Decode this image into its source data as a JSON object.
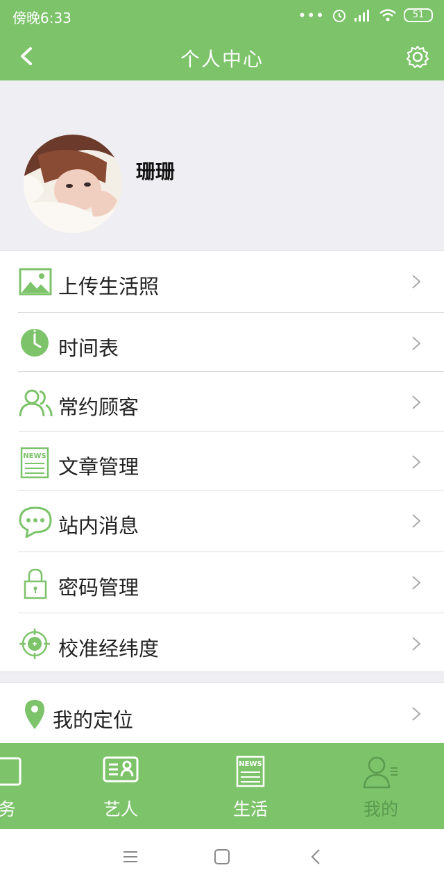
{
  "status_bar": {
    "time": "傍晚6:33",
    "battery": "51"
  },
  "nav": {
    "title": "个人中心"
  },
  "profile": {
    "username": "珊珊"
  },
  "menu": [
    {
      "label": "上传生活照",
      "icon": "picture-icon"
    },
    {
      "label": "时间表",
      "icon": "clock-icon"
    },
    {
      "label": "常约顾客",
      "icon": "users-icon"
    },
    {
      "label": "文章管理",
      "icon": "news-icon"
    },
    {
      "label": "站内消息",
      "icon": "chat-bubble-icon"
    },
    {
      "label": "密码管理",
      "icon": "lock-icon"
    },
    {
      "label": "校准经纬度",
      "icon": "target-icon"
    }
  ],
  "location_item": {
    "label": "我的定位",
    "icon": "location-pin-icon"
  },
  "tabbar": [
    {
      "label": "务",
      "icon": "service-icon",
      "active": true
    },
    {
      "label": "艺人",
      "icon": "artist-card-icon",
      "active": true
    },
    {
      "label": "生活",
      "icon": "news-icon",
      "active": true
    },
    {
      "label": "我的",
      "icon": "profile-icon",
      "active": false
    }
  ],
  "colors": {
    "brand_green": "#7cc36a",
    "background_gray": "#efeef3"
  }
}
